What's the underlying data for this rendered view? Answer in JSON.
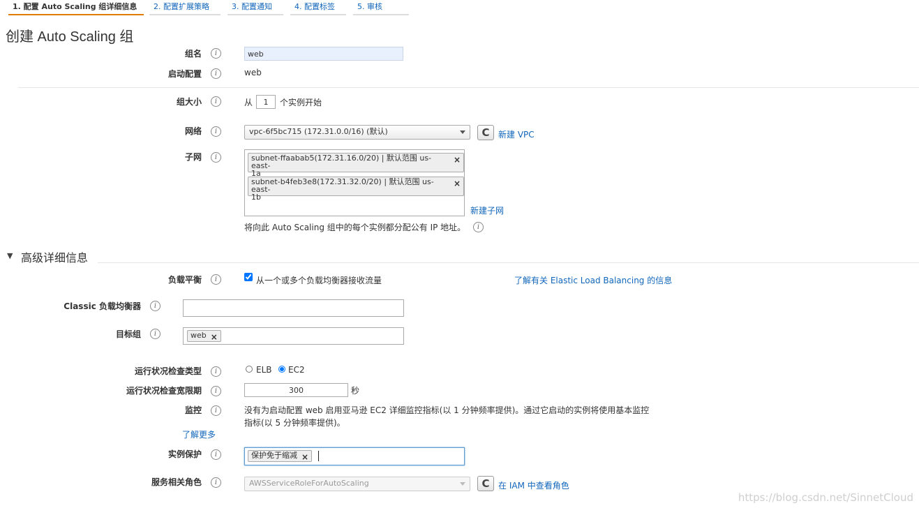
{
  "steps": [
    "1. 配置 Auto Scaling 组详细信息",
    "2. 配置扩展策略",
    "3. 配置通知",
    "4. 配置标签",
    "5. 审核"
  ],
  "page_title": "创建 Auto Scaling 组",
  "info_glyph": "i",
  "group_name": {
    "label": "组名",
    "value": "web"
  },
  "launch_config": {
    "label": "启动配置",
    "value": "web"
  },
  "group_size": {
    "label": "组大小",
    "prefix": "从",
    "value": "1",
    "suffix": "个实例开始"
  },
  "network": {
    "label": "网络",
    "selected": "vpc-6f5bc715 (172.31.0.0/16) (默认)",
    "create_link": "新建 VPC"
  },
  "subnet": {
    "label": "子网",
    "chips": [
      {
        "line1": "subnet-ffaabab5(172.31.16.0/20) | 默认范围 us-east-",
        "line2": "1a"
      },
      {
        "line1": "subnet-b4feb3e8(172.31.32.0/20) | 默认范围 us-east-",
        "line2": "1b"
      }
    ],
    "remove_glyph": "×",
    "create_link": "新建子网",
    "note": "将向此 Auto Scaling 组中的每个实例都分配公有 IP 地址。"
  },
  "advanced": {
    "toggle": "▼",
    "title": "高级详细信息"
  },
  "load_balancing": {
    "label": "负载平衡",
    "checkbox_label": "从一个或多个负载均衡器接收流量",
    "checked": true,
    "learn_link": "了解有关 Elastic Load Balancing 的信息"
  },
  "classic_lb": {
    "label": "Classic 负载均衡器",
    "value": ""
  },
  "target_group": {
    "label": "目标组",
    "chip": "web"
  },
  "health_check_type": {
    "label": "运行状况检查类型",
    "option_elb": "ELB",
    "option_ec2": "EC2",
    "selected": "EC2"
  },
  "health_grace": {
    "label": "运行状况检查宽限期",
    "value": "300",
    "unit": "秒"
  },
  "monitoring": {
    "label": "监控",
    "line1": "没有为启动配置 web 启用亚马逊 EC2 详细监控指标(以 1 分钟频率提供)。通过它启动的实例将使用基本监控",
    "line2": "指标(以 5 分钟频率提供)。",
    "learn_more": "了解更多"
  },
  "instance_protection": {
    "label": "实例保护",
    "chip": "保护免于缩减"
  },
  "service_role": {
    "label": "服务相关角色",
    "selected": "AWSServiceRoleForAutoScaling",
    "iam_link": "在 IAM 中查看角色"
  },
  "refresh_glyph": "C",
  "watermark": "https://blog.csdn.net/SinnetCloud",
  "colors": {
    "link": "#1166bb",
    "active_step_underline": "#e07b00",
    "focus_border": "#5b9bd5"
  }
}
